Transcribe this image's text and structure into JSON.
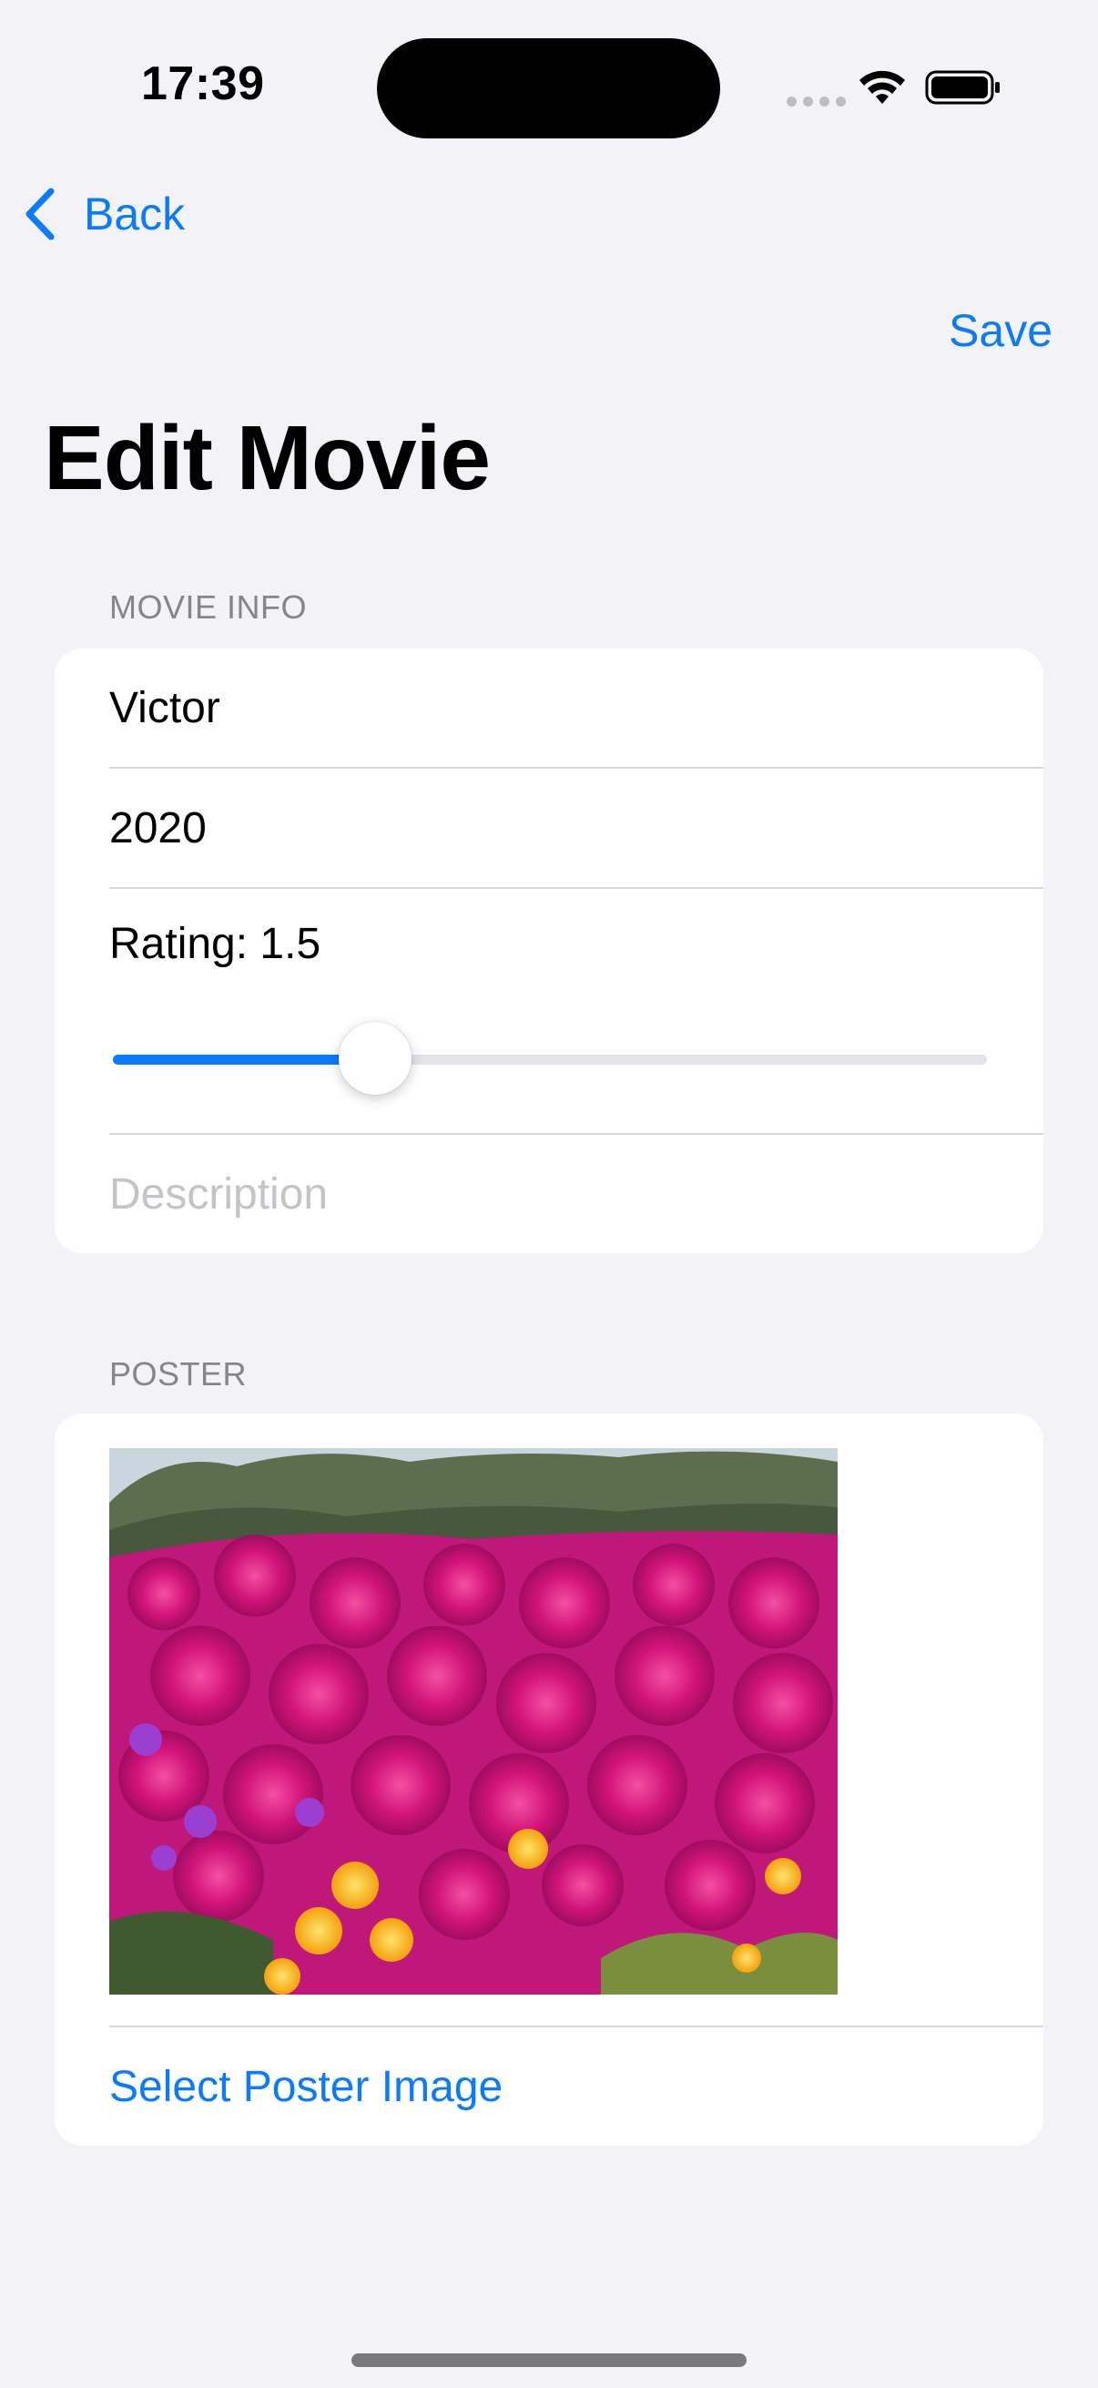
{
  "status_bar": {
    "time": "17:39"
  },
  "nav": {
    "back_label": "Back",
    "save_label": "Save",
    "title": "Edit Movie"
  },
  "movie_info": {
    "header": "MOVIE INFO",
    "title_value": "Victor",
    "year_value": "2020",
    "rating_label": "Rating: 1.5",
    "rating_value": 1.5,
    "description_placeholder": "Description"
  },
  "poster": {
    "header": "POSTER",
    "image_alt": "Pink and magenta ice plant flowers with yellow blooms",
    "select_label": "Select Poster Image"
  },
  "colors": {
    "accent": "#0a7aff",
    "background": "#f2f2f7",
    "card": "#ffffff",
    "secondary_text": "#85858b",
    "placeholder": "#c4c4c8"
  },
  "icons": {
    "back": "chevron-left-icon",
    "wifi": "wifi-icon",
    "battery": "battery-icon",
    "signal": "cellular-signal-icon"
  }
}
